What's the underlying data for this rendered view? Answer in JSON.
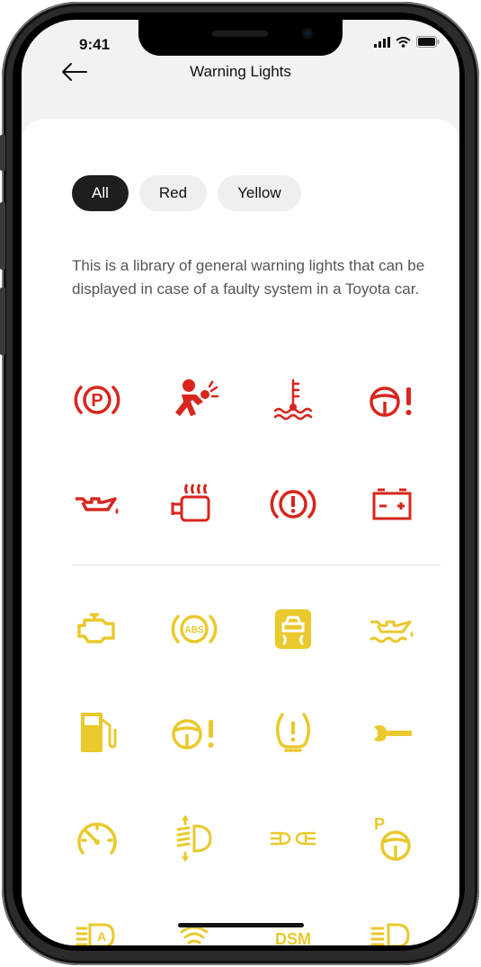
{
  "status_bar": {
    "time": "9:41"
  },
  "header": {
    "title": "Warning Lights"
  },
  "filters": [
    {
      "label": "All",
      "active": true
    },
    {
      "label": "Red",
      "active": false
    },
    {
      "label": "Yellow",
      "active": false
    }
  ],
  "description": "This is a library of general warning lights that can be displayed in case of a faulty system in a Toyota car.",
  "colors": {
    "red": "#d8261d",
    "yellow": "#e9c92b",
    "active_chip": "#1e1e1e"
  },
  "red_icons": [
    "parking-brake-icon",
    "airbag-icon",
    "coolant-temperature-icon",
    "power-steering-icon",
    "oil-pressure-icon",
    "engine-preheat-icon",
    "brake-warning-icon",
    "battery-icon"
  ],
  "yellow_icons": [
    "check-engine-icon",
    "abs-icon",
    "traction-control-icon",
    "oil-level-icon",
    "fuel-icon",
    "steering-warning-icon",
    "tire-pressure-icon",
    "wrench-icon",
    "speedometer-icon",
    "headlight-level-icon",
    "fog-light-icon",
    "parking-steering-icon",
    "auto-headlight-icon",
    "rear-fog-icon",
    "dsm-icon",
    "headlight-icon"
  ],
  "icon_text": {
    "parking": "P",
    "abs": "ABS",
    "auto": "A",
    "dsm": "DSM"
  }
}
